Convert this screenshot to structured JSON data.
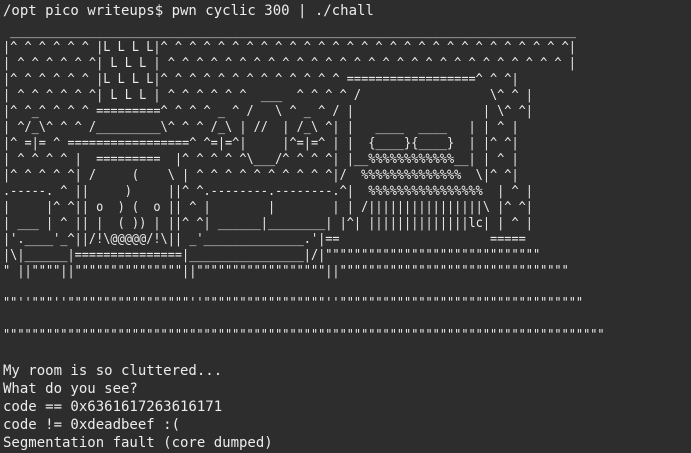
{
  "terminal": {
    "command_line": "/opt pico writeups$ pwn cyclic 300 | ./chall",
    "ascii_art": [
      " _______________________________________________________________________________",
      "|^ ^ ^ ^ ^ ^ |L L L L|^ ^ ^ ^ ^ ^ ^ ^ ^ ^ ^ ^ ^ ^ ^ ^ ^ ^ ^ ^ ^ ^ ^ ^ ^ ^ ^ ^ ^|",
      "| ^ ^ ^ ^ ^ ^| L L L | ^ ^ ^ ^ ^ ^ ^ ^ ^ ^ ^ ^ ^ ^ ^ ^ ^ ^ ^ ^ ^ ^ ^ ^ ^ ^ ^ ^ |",
      "|^ ^ ^ ^ ^ ^ |L L L L|^ ^ ^ ^ ^ ^ ^ ^ ^ ^ ^ ^ ^ ==================^ ^ ^|",
      "| ^ ^ ^ ^ ^ ^| L L L | ^ ^ ^ ^ ^ ^  ___  ^ ^ ^ ^ /                  \\^ ^ |",
      "|^ ^_^ ^ ^ ^ =========^ ^ ^ ^ _ ^ /   \\ ^ _ ^ / |                  | \\^ ^|",
      "| ^/_\\^ ^ ^ /_________\\^ ^ ^ /_\\ | //  | /_\\ ^| |   ____  ____   | | ^ |",
      "|^ =|= ^ =================^ ^=|=^|     |^=|=^ | |  {____}{____}  | |^ ^|",
      "| ^ ^ ^ ^ |  =========  |^ ^ ^ ^ ^\\___/^ ^ ^ ^| |__%%%%%%%%%%%%__| | ^ |",
      "|^ ^ ^ ^ ^| /     (    \\ | ^ ^ ^ ^ ^ ^ ^ ^ ^ ^|/  %%%%%%%%%%%%%%  \\|^ ^|",
      ".-----. ^ ||     )     ||^ ^.--------.--------.^|  %%%%%%%%%%%%%%%%  | ^ |",
      "|     |^ ^|| o  ) (  o || ^ |        |        | | /||||||||||||||||\\ |^ ^|",
      "| ___ | ^ || |  ( )) | ||^ ^| ______|________| |^| ||||||||||||||lc| | ^ |",
      "|'.____'_^||/!\\@@@@@/!\\|| _'______________.'|==                     =====",
      "|\\|______|===============|________________|/|\"\"\"\"\"\"\"\"\"\"\"\"\"\"\"\"\"\"\"\"\"\"\"\"\"\"\"\"\"\"",
      "\" ||\"\"\"\"||\"\"\"\"\"\"\"\"\"\"\"\"\"\"\"||\"\"\"\"\"\"\"\"\"\"\"\"\"\"\"\"\"\"||\"\"\"\"\"\"\"\"\"\"\"\"\"\"\"\"\"\"\"\"\"\"\"\"\"\"\"\"\"\"\"\"",
      "\"\"''\"\"\"''\"\"\"\"\"\"\"\"\"\"\"\"\"\"\"\"\"''\"\"\"\"\"\"\"\"\"\"\"\"\"\"\"\"\"''\"\"\"\"\"\"\"\"\"\"\"\"\"\"\"\"\"\"\"\"\"\"\"\"\"\"\"\"\"\"\"\"\"\"",
      "\"\"\"\"\"\"\"\"\"\"\"\"\"\"\"\"\"\"\"\"\"\"\"\"\"\"\"\"\"\"\"\"\"\"\"\"\"\"\"\"\"\"\"\"\"\"\"\"\"\"\"\"\"\"\"\"\"\"\"\"\"\"\"\"\"\"\"\"\"\"\"\"\"\"\"\"\"\"\"\"\"\"\"\""
    ],
    "output_lines": [
      "My room is so cluttered...",
      "What do you see?",
      "code == 0x6361617263616171",
      "code != 0xdeadbeef :(",
      "Segmentation fault (core dumped)"
    ]
  }
}
